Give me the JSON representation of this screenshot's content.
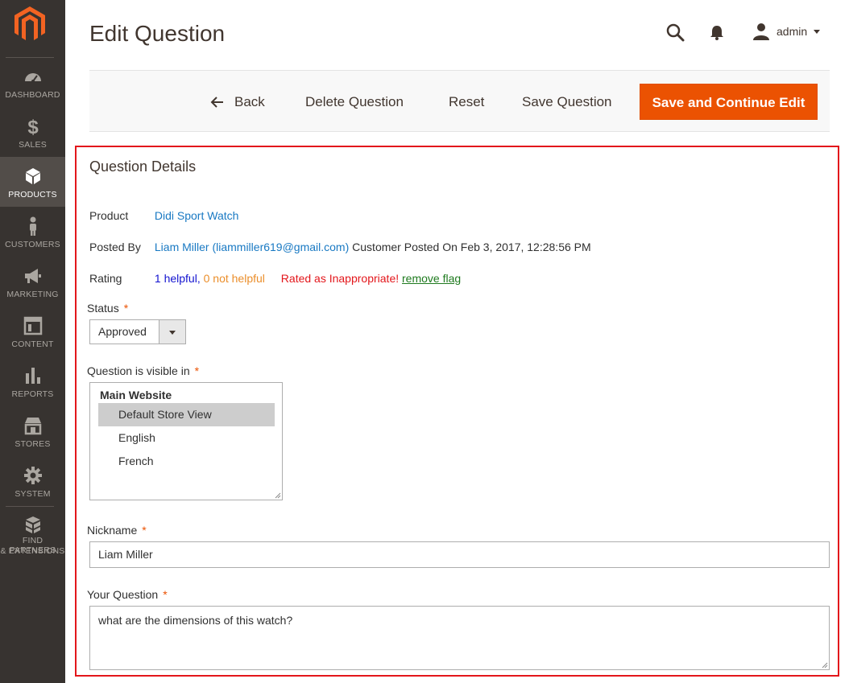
{
  "sidebar": {
    "logo_icon": "magento-logo-icon",
    "items": [
      {
        "label": "DASHBOARD",
        "icon": "dashboard-icon"
      },
      {
        "label": "SALES",
        "icon": "dollar-icon"
      },
      {
        "label": "PRODUCTS",
        "icon": "box-icon",
        "active": true
      },
      {
        "label": "CUSTOMERS",
        "icon": "person-icon"
      },
      {
        "label": "MARKETING",
        "icon": "megaphone-icon"
      },
      {
        "label": "CONTENT",
        "icon": "layout-icon"
      },
      {
        "label": "REPORTS",
        "icon": "bar-chart-icon"
      },
      {
        "label": "STORES",
        "icon": "storefront-icon"
      },
      {
        "label": "SYSTEM",
        "icon": "gear-icon"
      },
      {
        "label_line1": "FIND PARTNERS",
        "label_line2": "& EXTENSIONS",
        "icon": "blocks-icon"
      }
    ]
  },
  "header": {
    "title": "Edit Question",
    "user": "admin"
  },
  "actions": {
    "back": "Back",
    "delete": "Delete Question",
    "reset": "Reset",
    "save": "Save Question",
    "save_continue": "Save and Continue Edit"
  },
  "details": {
    "section_title": "Question Details",
    "product_label": "Product",
    "product_value": "Didi Sport Watch",
    "posted_by_label": "Posted By",
    "posted_by_name": "Liam Miller (liammiller619@gmail.com)",
    "posted_by_suffix": " Customer Posted On Feb 3, 2017, 12:28:56 PM",
    "rating_label": "Rating",
    "rating_helpful": "1 helpful,",
    "rating_not_helpful": "0 not helpful",
    "rating_inappropriate": "Rated as Inappropriate!",
    "rating_remove_flag": "remove flag"
  },
  "form": {
    "status_label": "Status",
    "status_value": "Approved",
    "visible_label": "Question is visible in",
    "visible_group": "Main Website",
    "visible_options": [
      "Default Store View",
      "English",
      "French"
    ],
    "visible_selected": "Default Store View",
    "nickname_label": "Nickname",
    "nickname_value": "Liam Miller",
    "question_label": "Your Question",
    "question_value": "what are the dimensions of this watch?",
    "required_mark": "*"
  },
  "colors": {
    "sidebar_bg": "#373330",
    "primary_button": "#eb5202",
    "highlight_border": "#e3161b",
    "link": "#1979c3"
  }
}
